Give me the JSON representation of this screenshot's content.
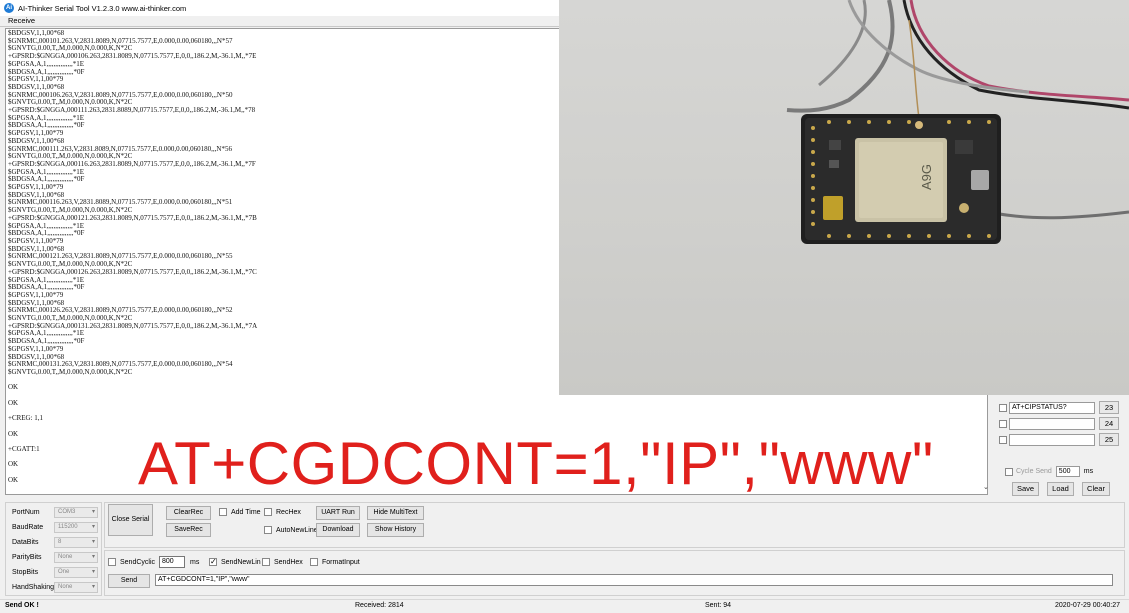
{
  "window": {
    "title": "AI-Thinker Serial Tool V1.2.3.0    www.ai-thinker.com"
  },
  "receive_label": "Receive",
  "log": [
    "$BDGSV,1,1,00*68",
    "$GNRMC,000101.263,V,2831.8089,N,07715.7577,E,0.000,0.00,060180,,,N*57",
    "$GNVTG,0.00,T,,M,0.000,N,0.000,K,N*2C",
    "+GPSRD:$GNGGA,000106.263,2831.8089,N,07715.7577,E,0,0,,186.2,M,-36.1,M,,*7E",
    "$GPGSA,A,1,,,,,,,,,,,,,,,*1E",
    "$BDGSA,A,1,,,,,,,,,,,,,,,*0F",
    "$GPGSV,1,1,00*79",
    "$BDGSV,1,1,00*68",
    "$GNRMC,000106.263,V,2831.8089,N,07715.7577,E,0.000,0.00,060180,,,N*50",
    "$GNVTG,0.00,T,,M,0.000,N,0.000,K,N*2C",
    "+GPSRD:$GNGGA,000111.263,2831.8089,N,07715.7577,E,0,0,,186.2,M,-36.1,M,,*78",
    "$GPGSA,A,1,,,,,,,,,,,,,,,*1E",
    "$BDGSA,A,1,,,,,,,,,,,,,,,*0F",
    "$GPGSV,1,1,00*79",
    "$BDGSV,1,1,00*68",
    "$GNRMC,000111.263,V,2831.8089,N,07715.7577,E,0.000,0.00,060180,,,N*56",
    "$GNVTG,0.00,T,,M,0.000,N,0.000,K,N*2C",
    "+GPSRD:$GNGGA,000116.263,2831.8089,N,07715.7577,E,0,0,,186.2,M,-36.1,M,,*7F",
    "$GPGSA,A,1,,,,,,,,,,,,,,,*1E",
    "$BDGSA,A,1,,,,,,,,,,,,,,,*0F",
    "$GPGSV,1,1,00*79",
    "$BDGSV,1,1,00*68",
    "$GNRMC,000116.263,V,2831.8089,N,07715.7577,E,0.000,0.00,060180,,,N*51",
    "$GNVTG,0.00,T,,M,0.000,N,0.000,K,N*2C",
    "+GPSRD:$GNGGA,000121.263,2831.8089,N,07715.7577,E,0,0,,186.2,M,-36.1,M,,*7B",
    "$GPGSA,A,1,,,,,,,,,,,,,,,*1E",
    "$BDGSA,A,1,,,,,,,,,,,,,,,*0F",
    "$GPGSV,1,1,00*79",
    "$BDGSV,1,1,00*68",
    "$GNRMC,000121.263,V,2831.8089,N,07715.7577,E,0.000,0.00,060180,,,N*55",
    "$GNVTG,0.00,T,,M,0.000,N,0.000,K,N*2C",
    "+GPSRD:$GNGGA,000126.263,2831.8089,N,07715.7577,E,0,0,,186.2,M,-36.1,M,,*7C",
    "$GPGSA,A,1,,,,,,,,,,,,,,,*1E",
    "$BDGSA,A,1,,,,,,,,,,,,,,,*0F",
    "$GPGSV,1,1,00*79",
    "$BDGSV,1,1,00*68",
    "$GNRMC,000126.263,V,2831.8089,N,07715.7577,E,0.000,0.00,060180,,,N*52",
    "$GNVTG,0.00,T,,M,0.000,N,0.000,K,N*2C",
    "+GPSRD:$GNGGA,000131.263,2831.8089,N,07715.7577,E,0,0,,186.2,M,-36.1,M,,*7A",
    "$GPGSA,A,1,,,,,,,,,,,,,,,*1E",
    "$BDGSA,A,1,,,,,,,,,,,,,,,*0F",
    "$GPGSV,1,1,00*79",
    "$BDGSV,1,1,00*68",
    "$GNRMC,000131.263,V,2831.8089,N,07715.7577,E,0.000,0.00,060180,,,N*54",
    "$GNVTG,0.00,T,,M,0.000,N,0.000,K,N*2C",
    "",
    "OK",
    "",
    "OK",
    "",
    "+CREG: 1,1",
    "",
    "OK",
    "",
    "+CGATT:1",
    "",
    "OK",
    "",
    "OK"
  ],
  "overlay_caption": "AT+CGDCONT=1,\"IP\",\"www\"",
  "photo": {
    "module_label": "A9G"
  },
  "multi_send": [
    {
      "text": "AT+CIPSTATUS?",
      "number": "23"
    },
    {
      "text": "",
      "number": "24"
    },
    {
      "text": "",
      "number": "25"
    }
  ],
  "cycle_send": {
    "label": "Cycle Send",
    "value": "500",
    "unit": "ms"
  },
  "panel_buttons": {
    "save": "Save",
    "load": "Load",
    "clear": "Clear"
  },
  "settings": {
    "port_num": {
      "label": "PortNum",
      "value": "COM3"
    },
    "baud_rate": {
      "label": "BaudRate",
      "value": "115200"
    },
    "data_bits": {
      "label": "DataBits",
      "value": "8"
    },
    "parity_bits": {
      "label": "ParityBits",
      "value": "None"
    },
    "stop_bits": {
      "label": "StopBits",
      "value": "One"
    },
    "hand_shaking": {
      "label": "HandShaking",
      "value": "None"
    }
  },
  "buttons": {
    "close_serial": "Close Serial",
    "clear_rec": "ClearRec",
    "save_rec": "SaveRec",
    "uart_run": "UART Run",
    "download": "Download",
    "hide_multitext": "Hide MultiText",
    "show_history": "Show History",
    "send": "Send"
  },
  "options": {
    "add_time": "Add Time",
    "rec_hex": "RecHex",
    "auto_new_line": "AutoNewLine",
    "send_cyclic": "SendCyclic",
    "send_cyclic_value": "800",
    "send_cyclic_unit": "ms",
    "send_new_line": "SendNewLin",
    "send_hex": "SendHex",
    "format_input": "FormatInput"
  },
  "send_input": "AT+CGDCONT=1,\"IP\",\"www\"",
  "status_bar": {
    "left": "Send OK !",
    "received": "Received: 2814",
    "sent": "Sent: 94",
    "datetime": "2020-07-29 00:40:27"
  }
}
